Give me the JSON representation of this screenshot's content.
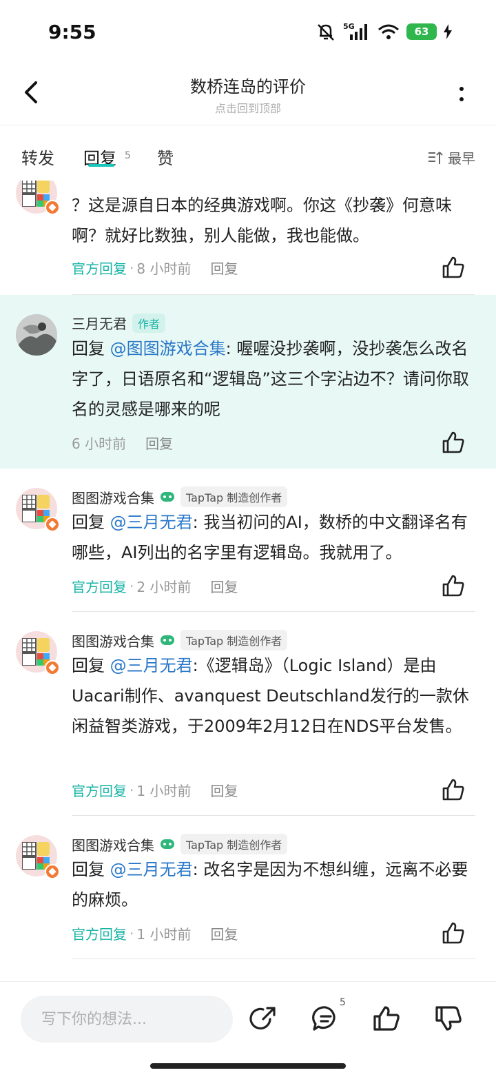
{
  "status_bar": {
    "time": "9:55",
    "network": "5G",
    "battery": "63"
  },
  "header": {
    "title": "数桥连岛的评价",
    "subtitle": "点击回到顶部"
  },
  "tabs": {
    "forward": "转发",
    "reply": "回复",
    "reply_count": "5",
    "like": "赞",
    "sort": "最早"
  },
  "comments": [
    {
      "text": "？这是源自日本的经典游戏啊。你这《抄袭》何意味啊？就好比数独，别人能做，我也能做。",
      "official": "官方回复",
      "time": "8 小时前",
      "reply": "回复"
    },
    {
      "name": "三月无君",
      "tag": "作者",
      "prefix": "回复 ",
      "mention": "@图图游戏合集",
      "text": ": 喔喔没抄袭啊，没抄袭怎么改名字了，日语原名和“逻辑岛”这三个字沾边不？请问你取名的灵感是哪来的呢",
      "time": "6 小时前",
      "reply": "回复"
    },
    {
      "name": "图图游戏合集",
      "tag": "TapTap 制造创作者",
      "prefix": "回复 ",
      "mention": "@三月无君",
      "text": ": 我当初问的AI，数桥的中文翻译名有哪些，AI列出的名字里有逻辑岛。我就用了。",
      "official": "官方回复",
      "time": "2 小时前",
      "reply": "回复"
    },
    {
      "name": "图图游戏合集",
      "tag": "TapTap 制造创作者",
      "prefix": "回复 ",
      "mention": "@三月无君",
      "text": ":《逻辑岛》（Logic Island）是由Uacari制作、avanquest Deutschland发行的一款休闲益智类游戏，于2009年2月12日在NDS平台发售。",
      "official": "官方回复",
      "time": "1 小时前",
      "reply": "回复"
    },
    {
      "name": "图图游戏合集",
      "tag": "TapTap 制造创作者",
      "prefix": "回复 ",
      "mention": "@三月无君",
      "text": ": 改名字是因为不想纠缠，远离不必要的麻烦。",
      "official": "官方回复",
      "time": "1 小时前",
      "reply": "回复"
    }
  ],
  "bottom_bar": {
    "placeholder": "写下你的想法...",
    "comment_count": "5"
  },
  "colors": {
    "accent": "#16c6b9",
    "mention": "#2a78c9",
    "highlight_bg": "#e8f9f5",
    "official": "#17b3a6"
  },
  "icons": [
    "back-icon",
    "more-icon",
    "sort-icon",
    "like-icon",
    "share-icon",
    "comment-icon",
    "thumb-up-icon",
    "thumb-down-icon"
  ]
}
